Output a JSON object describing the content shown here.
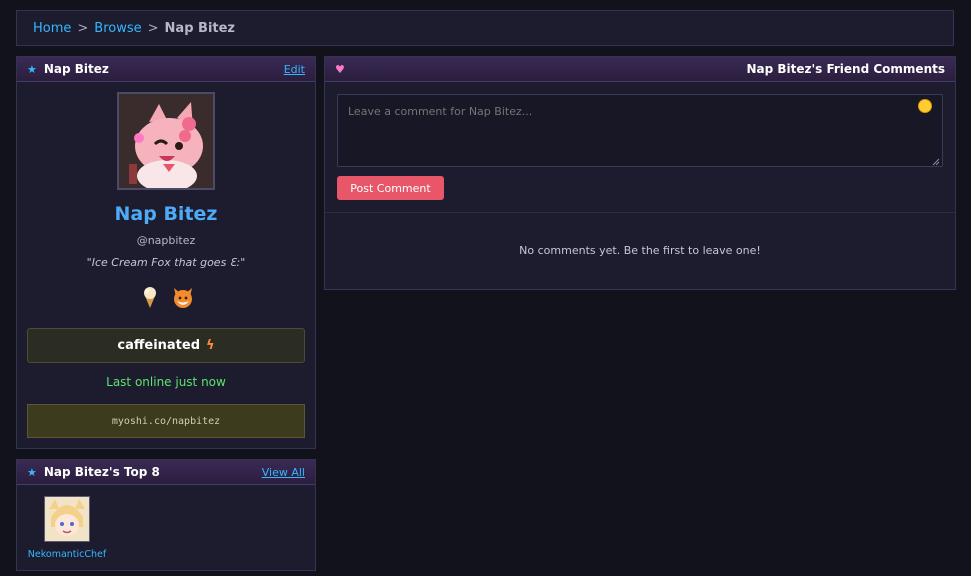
{
  "breadcrumb": {
    "items": [
      "Home",
      "Browse"
    ],
    "separator": ">",
    "current": "Nap Bitez"
  },
  "profile": {
    "header_title": "Nap Bitez",
    "edit_label": "Edit",
    "display_name": "Nap Bitez",
    "handle": "@napbitez",
    "tagline": "\"Ice Cream Fox that goes Ɛ:\"",
    "emojis": [
      "ice-cream-icon",
      "fox-icon"
    ],
    "mood": "caffeinated",
    "mood_icon": "lightning-icon",
    "online_status": "Last online just now",
    "url": "myoshi.co/napbitez"
  },
  "top8": {
    "header_title": "Nap Bitez's Top 8",
    "view_all_label": "View All",
    "friends": [
      {
        "name": "NekomanticChef"
      }
    ]
  },
  "comments": {
    "header_title": "Nap Bitez's Friend Comments",
    "placeholder": "Leave a comment for Nap Bitez...",
    "post_label": "Post Comment",
    "empty_message": "No comments yet. Be the first to leave one!"
  },
  "colors": {
    "accent_link": "#35b6ff",
    "name_blue": "#4faaf7",
    "online_green": "#5ee36c",
    "post_button": "#e8566a",
    "heart": "#ff7ac6"
  }
}
